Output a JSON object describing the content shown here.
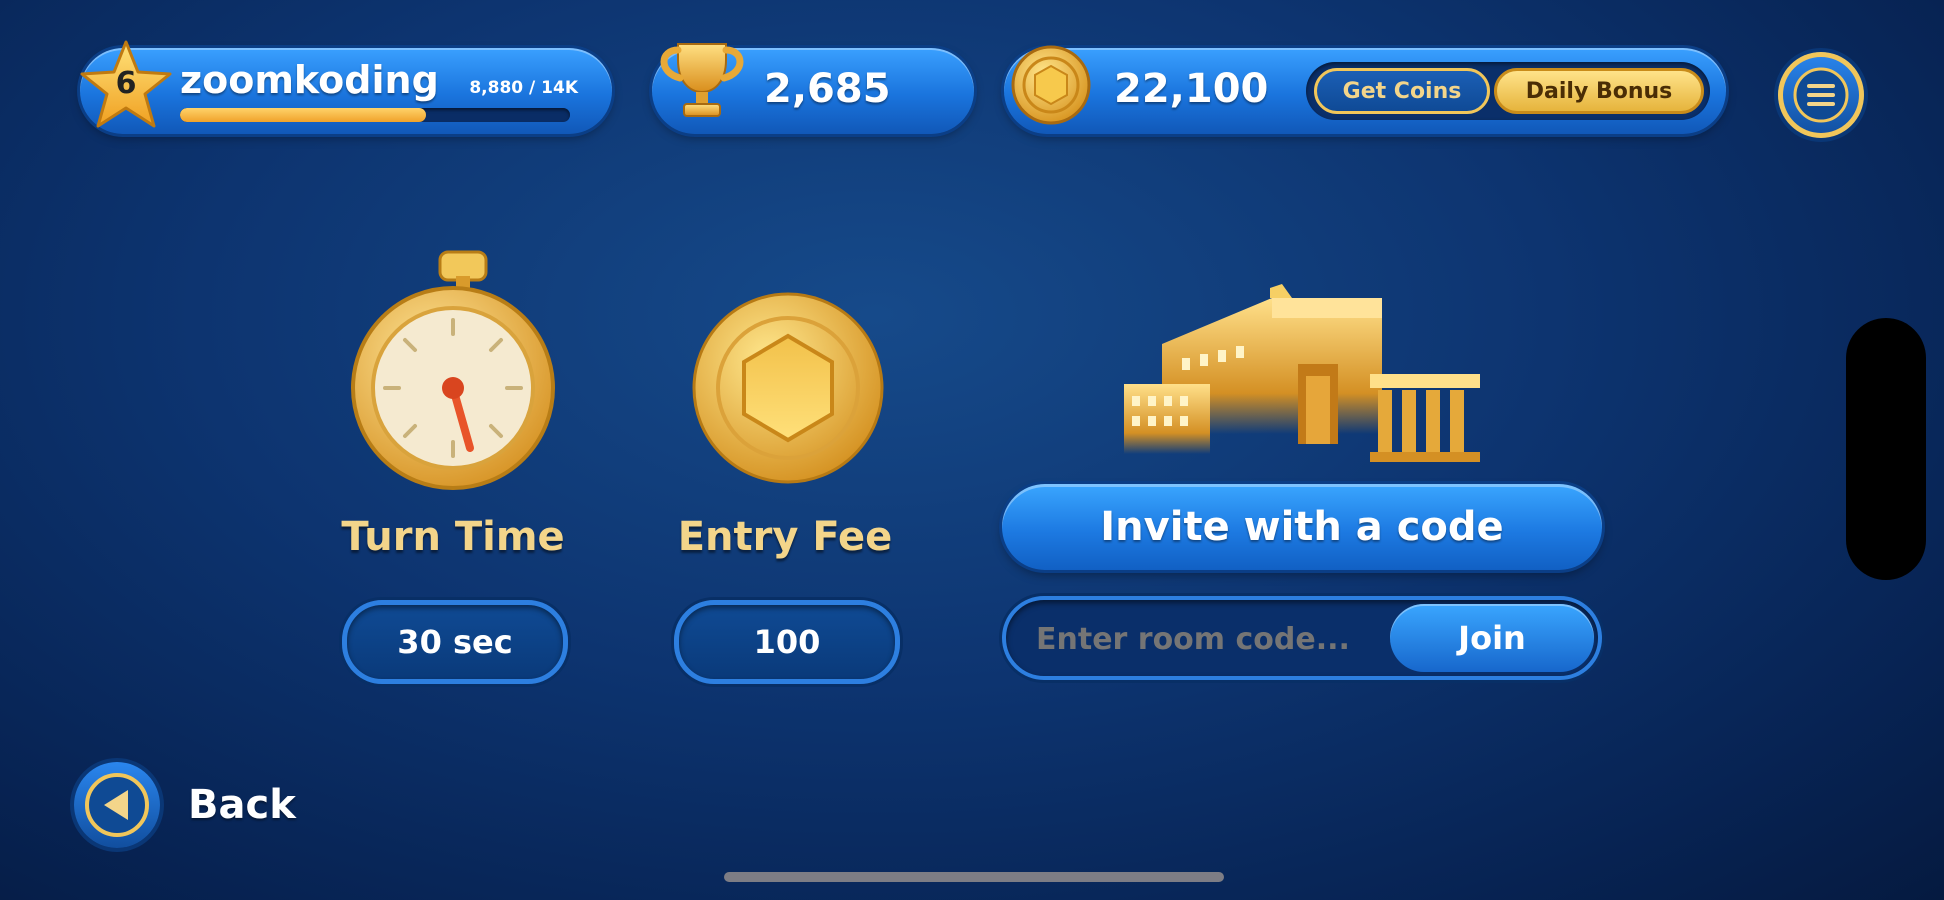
{
  "header": {
    "profile": {
      "level": "6",
      "username": "zoomkoding",
      "xp_text": "8,880 / 14K",
      "xp_progress": 0.63
    },
    "trophies": {
      "value": "2,685"
    },
    "coins": {
      "value": "22,100",
      "get_coins_label": "Get Coins",
      "daily_bonus_label": "Daily Bonus"
    }
  },
  "settings": {
    "turn_time": {
      "label": "Turn Time",
      "value": "30 sec"
    },
    "entry_fee": {
      "label": "Entry Fee",
      "value": "100"
    }
  },
  "invite": {
    "button_label": "Invite with a code",
    "room_code_placeholder": "Enter room code...",
    "join_label": "Join"
  },
  "footer": {
    "back_label": "Back"
  },
  "icons": [
    "level-star-icon",
    "trophy-icon",
    "coin-icon",
    "menu-icon",
    "stopwatch-icon",
    "entry-coin-icon",
    "temple-icon",
    "back-arrow-icon"
  ],
  "colors": {
    "accent_blue": "#2a86ee",
    "gold": "#f3d58a",
    "background": "#0d3470"
  }
}
